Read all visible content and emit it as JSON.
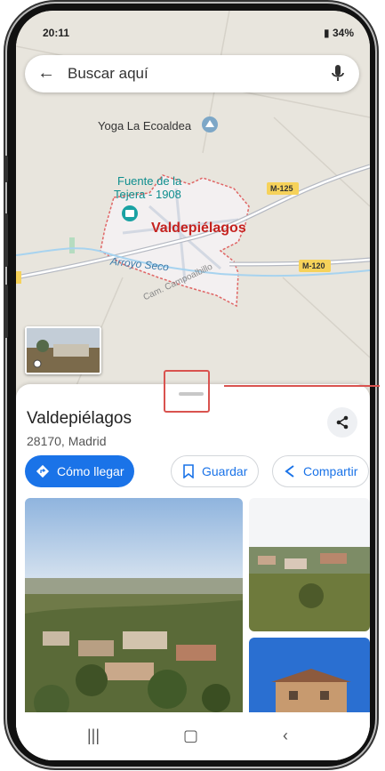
{
  "status_bar": {
    "time": "20:11",
    "right_text": "34%"
  },
  "search": {
    "placeholder": "Buscar aquí"
  },
  "map": {
    "poi_yoga": "Yoga La Ecoaldea",
    "poi_fuente_line1": "Fuente de la",
    "poi_fuente_line2": "Tejera - 1908",
    "town": "Valdepiélagos",
    "road1": "M-125",
    "road2": "M-120",
    "river": "Arroyo Seco",
    "path": "Cam. Campoalbillo"
  },
  "place": {
    "name": "Valdepiélagos",
    "address": "28170, Madrid"
  },
  "actions": {
    "directions": "Cómo llegar",
    "save": "Guardar",
    "share": "Compartir"
  },
  "colors": {
    "accent": "#1a73e8",
    "highlight": "#d9534f",
    "town_label": "#c5221f"
  }
}
